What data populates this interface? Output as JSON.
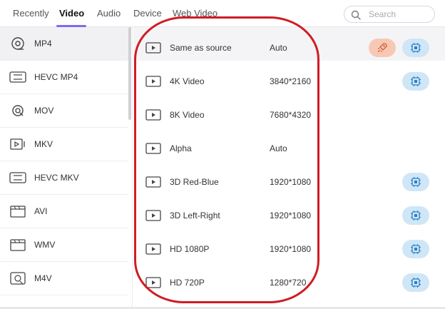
{
  "tabs": [
    {
      "label": "Recently",
      "active": false
    },
    {
      "label": "Video",
      "active": true
    },
    {
      "label": "Audio",
      "active": false
    },
    {
      "label": "Device",
      "active": false
    },
    {
      "label": "Web Video",
      "active": false
    }
  ],
  "search": {
    "placeholder": "Search",
    "value": ""
  },
  "formats": [
    {
      "label": "MP4",
      "icon": "disc-icon",
      "active": true
    },
    {
      "label": "HEVC MP4",
      "icon": "hevc-icon",
      "active": false
    },
    {
      "label": "MOV",
      "icon": "quicktime-icon",
      "active": false
    },
    {
      "label": "MKV",
      "icon": "video-file-icon",
      "active": false
    },
    {
      "label": "HEVC MKV",
      "icon": "hevc-icon",
      "active": false
    },
    {
      "label": "AVI",
      "icon": "clapper-icon",
      "active": false
    },
    {
      "label": "WMV",
      "icon": "clapper-icon",
      "active": false
    },
    {
      "label": "M4V",
      "icon": "m4v-icon",
      "active": false
    }
  ],
  "presets": [
    {
      "name": "Same as source",
      "resolution": "Auto",
      "rocket": true,
      "chip": true
    },
    {
      "name": "4K Video",
      "resolution": "3840*2160",
      "rocket": false,
      "chip": true
    },
    {
      "name": "8K Video",
      "resolution": "7680*4320",
      "rocket": false,
      "chip": false
    },
    {
      "name": "Alpha",
      "resolution": "Auto",
      "rocket": false,
      "chip": false
    },
    {
      "name": "3D Red-Blue",
      "resolution": "1920*1080",
      "rocket": false,
      "chip": true
    },
    {
      "name": "3D Left-Right",
      "resolution": "1920*1080",
      "rocket": false,
      "chip": true
    },
    {
      "name": "HD 1080P",
      "resolution": "1920*1080",
      "rocket": false,
      "chip": true
    },
    {
      "name": "HD 720P",
      "resolution": "1280*720",
      "rocket": false,
      "chip": true
    }
  ],
  "colors": {
    "accent": "#7c6cf0",
    "annotation": "#d01c24",
    "rocket_bg": "#f7c9b4",
    "chip_bg": "#cfe6f7"
  }
}
